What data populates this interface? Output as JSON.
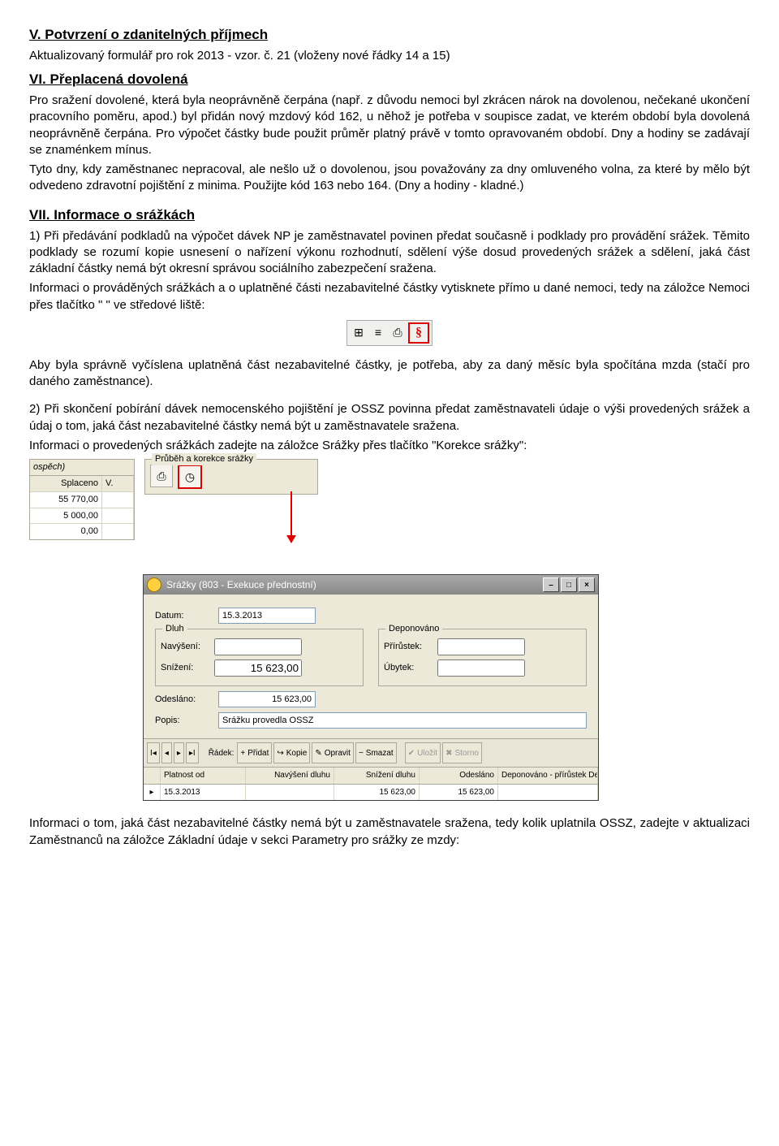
{
  "sectionV": {
    "heading": "V. Potvrzení o zdanitelných příjmech",
    "line1": "Aktualizovaný formulář pro rok 2013 - vzor. č. 21 (vloženy nové řádky 14 a 15)"
  },
  "sectionVI": {
    "heading": "VI. Přeplacená dovolená",
    "body": "Pro sražení dovolené, která byla neoprávněně čerpána (např. z důvodu nemoci byl zkrácen nárok na dovolenou, nečekané ukončení pracovního poměru, apod.) byl přidán nový mzdový kód 162, u něhož je potřeba v soupisce zadat, ve kterém období byla dovolená neoprávněně čerpána. Pro výpočet částky bude použit průměr platný právě v tomto opravovaném období. Dny a hodiny se zadávají se znaménkem mínus.",
    "body2": "Tyto dny, kdy zaměstnanec nepracoval, ale nešlo už o dovolenou, jsou považovány za dny omluveného volna, za které by mělo být odvedeno zdravotní pojištění z minima. Použijte kód 163 nebo 164. (Dny a hodiny - kladné.)"
  },
  "sectionVII": {
    "heading": "VII. Informace o srážkách",
    "p1": "1) Při předávání podkladů na výpočet dávek NP je zaměstnavatel povinen předat současně i podklady pro provádění srážek. Těmito podklady se rozumí kopie usnesení o nařízení výkonu rozhodnutí, sdělení výše dosud provedených srážek a sdělení, jaká část základní částky nemá být okresní správou sociálního zabezpečení sražena.",
    "p1b": "Informaci o prováděných srážkách a o uplatněné části nezabavitelné částky vytisknete přímo u dané nemoci, tedy na záložce Nemoci přes tlačítko \" \" ve středové liště:",
    "p2": "Aby byla správně vyčíslena uplatněná část nezabavitelné částky, je potřeba, aby za daný měsíc byla spočítána mzda (stačí pro daného zaměstnance).",
    "p3": "2) Při skončení pobírání dávek nemocenského pojištění je OSSZ povinna předat zaměstnavateli údaje o výši provedených srážek a údaj o tom, jaká část nezabavitelné částky nemá být u zaměstnavatele sražena.",
    "p3b": "Informaci o provedených srážkách zadejte na záložce Srážky přes tlačítko \"Korekce srážky\":",
    "pEnd": "Informaci o tom, jaká část nezabavitelné částky nemá být u zaměstnavatele sražena, tedy kolik uplatnila OSSZ, zadejte v aktualizaci Zaměstnanců na záložce Základní údaje v sekci Parametry pro srážky ze mzdy:"
  },
  "tb1": {
    "icon1": "⊞",
    "icon2": "≡",
    "icon3": "⎙",
    "iconS": "§"
  },
  "shot": {
    "lefthead": "ospěch)",
    "col1": "Splaceno",
    "col2": "V.",
    "rows": [
      "55 770,00",
      "5 000,00",
      "0,00"
    ],
    "legend": "Průběh a korekce srážky",
    "ico1": "⎙",
    "ico2": "◷"
  },
  "dialog": {
    "title": "Srážky (803 - Exekuce přednostní)",
    "minus": "–",
    "square": "□",
    "close": "×",
    "datum_label": "Datum:",
    "datum_value": "15.3.2013",
    "dluh_legend": "Dluh",
    "dep_legend": "Deponováno",
    "navyseni_label": "Navýšení:",
    "navyseni_value": "",
    "prirustek_label": "Přírůstek:",
    "prirustek_value": "",
    "snizeni_label": "Snížení:",
    "snizeni_value": "15 623,00",
    "ubytek_label": "Úbytek:",
    "ubytek_value": "",
    "odeslano_label": "Odesláno:",
    "odeslano_value": "15 623,00",
    "popis_label": "Popis:",
    "popis_value": "Srážku provedla OSSZ"
  },
  "footbar": {
    "first": "I◂",
    "prev": "◂",
    "next": "▸",
    "last": "▸I",
    "radek_label": "Řádek:",
    "pridat": "Přidat",
    "kopie": "Kopie",
    "opravit": "Opravit",
    "smazat": "Smazat",
    "ulozit": "Uložit",
    "storno": "Storno"
  },
  "grid": {
    "h0": "",
    "h1": "Platnost od",
    "h2": "Navýšení dluhu",
    "h3": "Snížení dluhu",
    "h4": "Odesláno",
    "h5": "Deponováno - přírůstek  De.",
    "r0": "▸",
    "r1": "15.3.2013",
    "r2": "",
    "r3": "15 623,00",
    "r4": "15 623,00",
    "r5": ""
  }
}
